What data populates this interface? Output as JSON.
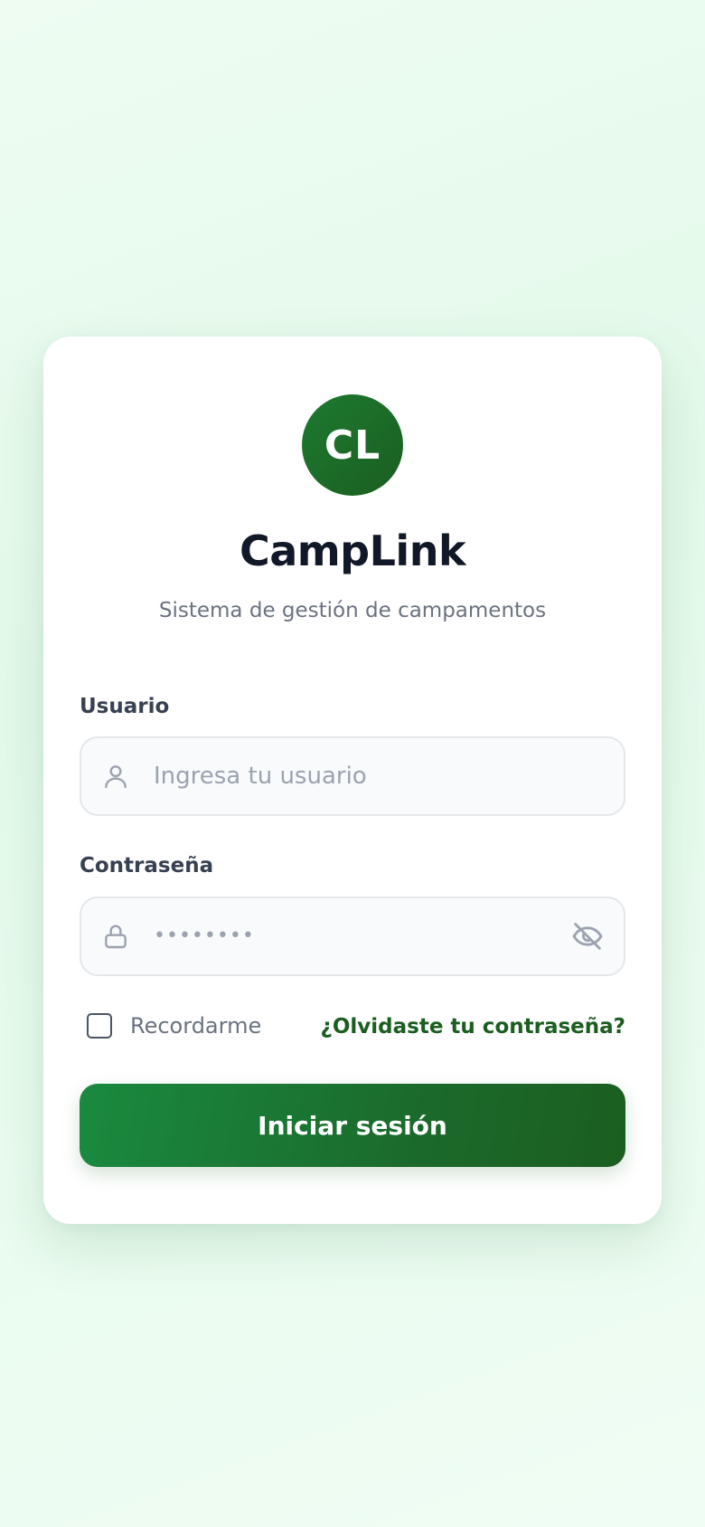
{
  "brand": {
    "logo_initials": "CL",
    "app_name": "CampLink",
    "subtitle": "Sistema de gestión de campamentos"
  },
  "form": {
    "username": {
      "label": "Usuario",
      "placeholder": "Ingresa tu usuario",
      "value": "",
      "icon": "user-icon"
    },
    "password": {
      "label": "Contraseña",
      "masked_value": "••••••••",
      "icon": "lock-icon",
      "toggle_icon": "eye-off-icon"
    },
    "remember_label": "Recordarme",
    "remember_checked": false,
    "forgot_label": "¿Olvidaste tu contraseña?",
    "submit_label": "Iniciar sesión"
  },
  "colors": {
    "brand_green": "#1b5e20",
    "title_text": "#111827",
    "muted_text": "#6b7280",
    "input_bg": "#f8fafc",
    "input_border": "#e5e7eb"
  }
}
